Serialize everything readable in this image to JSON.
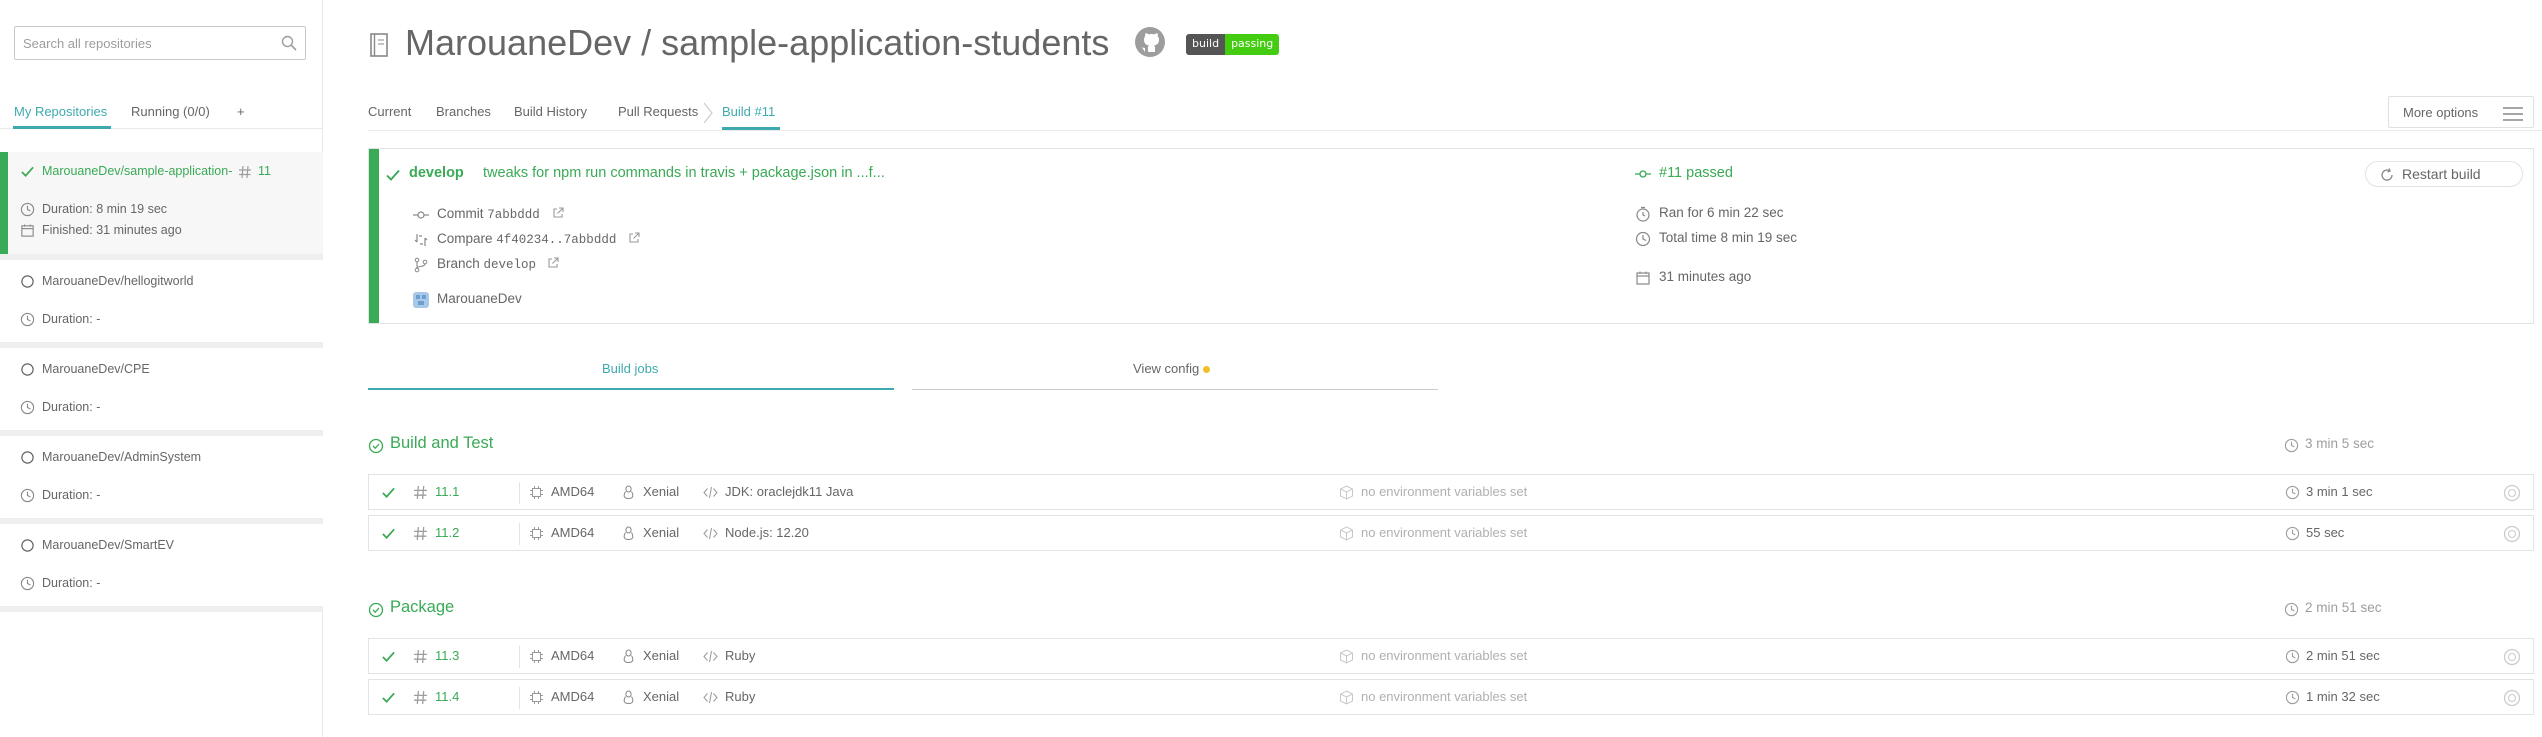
{
  "sidebar": {
    "search_placeholder": "Search all repositories",
    "tabs": {
      "mine": "My Repositories",
      "running": "Running (0/0)",
      "add": "+"
    },
    "repos": [
      {
        "name": "MarouaneDev/sample-application-students",
        "build_number": "11",
        "duration": "Duration: 8 min 19 sec",
        "finished": "Finished: 31 minutes ago",
        "state": "passed"
      },
      {
        "name": "MarouaneDev/hellogitworld",
        "duration": "Duration: -"
      },
      {
        "name": "MarouaneDev/CPE",
        "duration": "Duration: -"
      },
      {
        "name": "MarouaneDev/AdminSystem",
        "duration": "Duration: -"
      },
      {
        "name": "MarouaneDev/SmartEV",
        "duration": "Duration: -"
      }
    ]
  },
  "header": {
    "title": "MarouaneDev / sample-application-students",
    "badge": {
      "left": "build",
      "right": "passing"
    }
  },
  "nav": {
    "items": [
      "Current",
      "Branches",
      "Build History",
      "Pull Requests",
      "Build #11"
    ],
    "more_options": "More options"
  },
  "summary": {
    "branch": "develop",
    "commit_message": "tweaks for npm run commands in travis + package.json in ...f...",
    "commit_label": "Commit",
    "commit": "7abbddd",
    "compare_label": "Compare",
    "compare": "4f40234..7abbddd",
    "branch_label": "Branch",
    "branch_ref": "develop",
    "author": "MarouaneDev",
    "state": "#11 passed",
    "ran_for": "Ran for 6 min 22 sec",
    "total_time": "Total time 8 min 19 sec",
    "ago": "31 minutes ago",
    "restart": "Restart build"
  },
  "subtabs": {
    "jobs": "Build jobs",
    "config": "View config"
  },
  "stages": [
    {
      "title": "Build and Test",
      "duration": "3 min 5 sec",
      "jobs": [
        {
          "num": "11.1",
          "arch": "AMD64",
          "os": "Xenial",
          "lang": "JDK: oraclejdk11 Java",
          "env": "no environment variables set",
          "duration": "3 min 1 sec"
        },
        {
          "num": "11.2",
          "arch": "AMD64",
          "os": "Xenial",
          "lang": "Node.js: 12.20",
          "env": "no environment variables set",
          "duration": "55 sec"
        }
      ]
    },
    {
      "title": "Package",
      "duration": "2 min 51 sec",
      "jobs": [
        {
          "num": "11.3",
          "arch": "AMD64",
          "os": "Xenial",
          "lang": "Ruby",
          "env": "no environment variables set",
          "duration": "2 min 51 sec"
        },
        {
          "num": "11.4",
          "arch": "AMD64",
          "os": "Xenial",
          "lang": "Ruby",
          "env": "no environment variables set",
          "duration": "1 min 32 sec"
        }
      ]
    }
  ],
  "colors": {
    "passed": "#39aa56",
    "accent": "#3eaaaf",
    "text": "#666666",
    "muted": "#9d9d9d",
    "warning": "#f0c024"
  },
  "icons": [
    "search-icon",
    "check-icon",
    "hash-icon",
    "clock-icon",
    "calendar-icon",
    "circle-icon",
    "book-icon",
    "github-icon",
    "chevron-right-icon",
    "hamburger-icon",
    "commit-icon",
    "compare-icon",
    "branch-icon",
    "external-link-icon",
    "avatar-icon",
    "restart-icon",
    "stopwatch-icon",
    "stage-check-icon",
    "cpu-icon",
    "linux-icon",
    "code-icon",
    "cube-icon",
    "cancel-icon"
  ]
}
